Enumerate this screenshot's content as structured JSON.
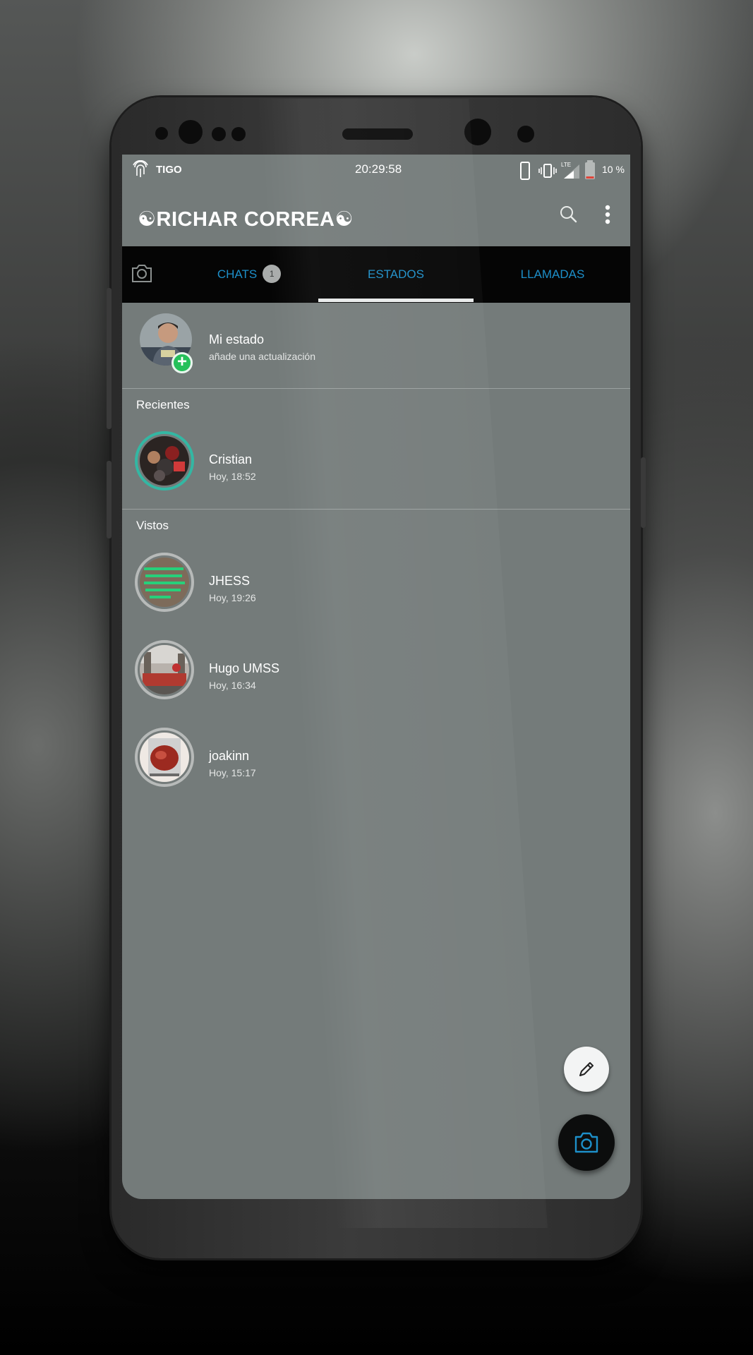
{
  "status_bar": {
    "carrier": "TIGO",
    "time": "20:29:58",
    "battery_percent": "10 %",
    "icons": [
      "fingerprint-icon",
      "phone-icon",
      "vibrate-icon",
      "lte-signal-icon",
      "battery-icon"
    ]
  },
  "appbar": {
    "title": "☯RICHAR CORREA☯",
    "icons": [
      "search-icon",
      "more-vert-icon"
    ]
  },
  "tabs": {
    "camera_icon": "camera-icon",
    "items": [
      {
        "label": "CHATS",
        "badge": "1"
      },
      {
        "label": "ESTADOS",
        "selected": true
      },
      {
        "label": "LLAMADAS"
      }
    ]
  },
  "my_status": {
    "name": "Mi estado",
    "subtitle": "añade una actualización",
    "add_icon": "plus-icon"
  },
  "recent": {
    "label": "Recientes",
    "items": [
      {
        "name": "Cristian",
        "time": "Hoy, 18:52"
      }
    ]
  },
  "viewed": {
    "label": "Vistos",
    "items": [
      {
        "name": "JHESS",
        "time": "Hoy, 19:26"
      },
      {
        "name": "Hugo UMSS",
        "time": "Hoy, 16:34"
      },
      {
        "name": "joakinn",
        "time": "Hoy, 15:17"
      }
    ]
  },
  "fabs": {
    "edit_icon": "pencil-icon",
    "camera_icon": "camera-icon"
  },
  "colors": {
    "screen_bg": "#747b7a",
    "tab_bar_bg": "#050505",
    "tab_text": "#1d8fc9",
    "new_status_ring": "#33b7a3",
    "seen_status_ring": "#b7bab9",
    "add_badge": "#25c05a"
  }
}
